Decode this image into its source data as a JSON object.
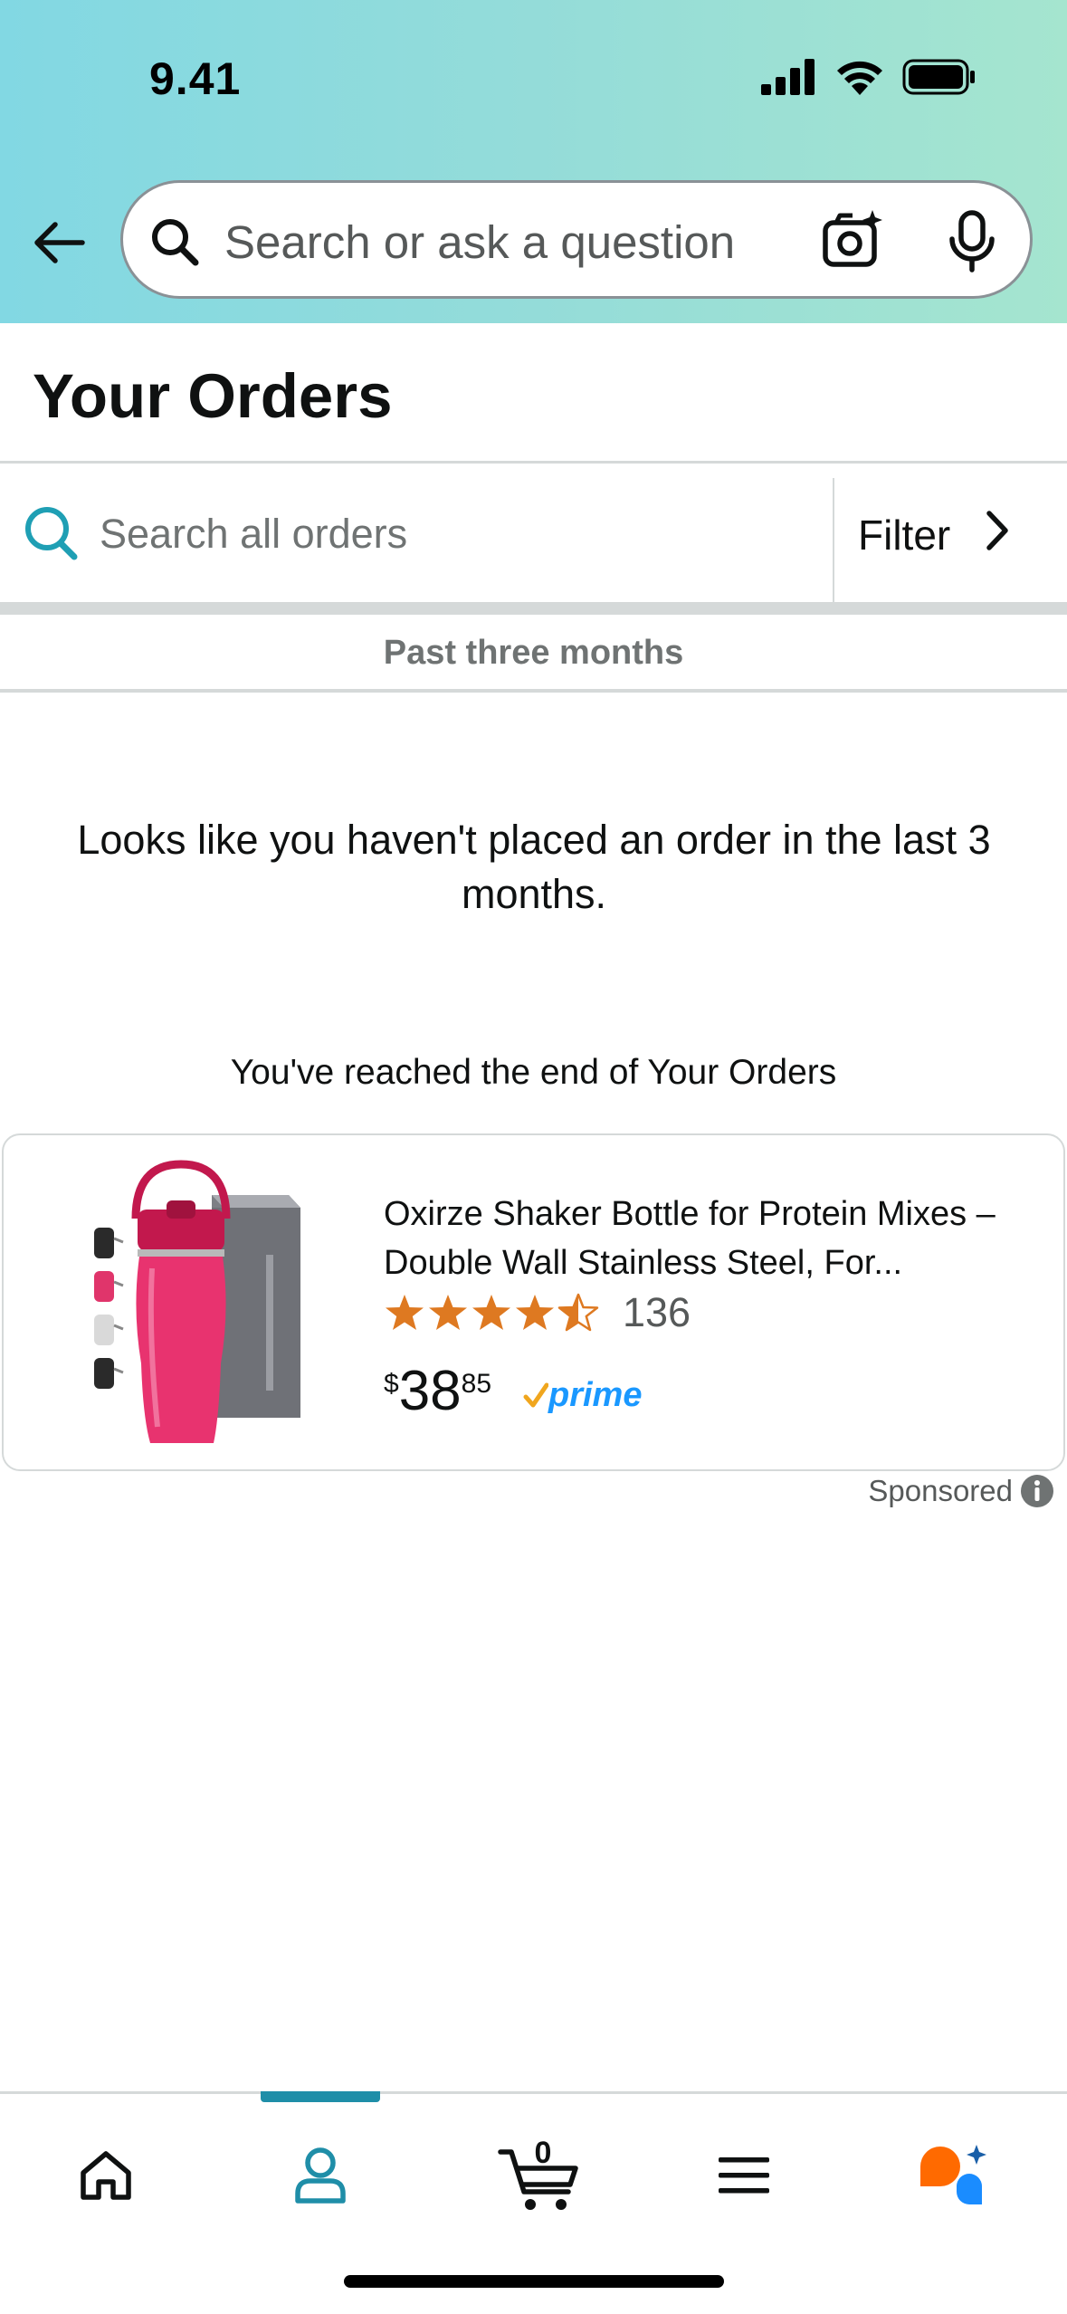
{
  "status_bar": {
    "time": "9.41"
  },
  "header": {
    "search_placeholder": "Search or ask a question"
  },
  "page": {
    "title": "Your Orders"
  },
  "order_search": {
    "placeholder": "Search all orders",
    "filter_label": "Filter"
  },
  "period": {
    "label": "Past three months"
  },
  "messages": {
    "empty": "Looks like you haven't placed an order in the last 3 months.",
    "end": "You've reached the end of Your Orders"
  },
  "sponsored_product": {
    "title": "Oxirze Shaker Bottle for Protein Mixes – Double Wall Stainless Steel, For...",
    "rating": 4.5,
    "review_count": "136",
    "price_symbol": "$",
    "price_whole": "38",
    "price_fraction": "85",
    "prime_label": "prime",
    "sponsored_label": "Sponsored"
  },
  "bottom_nav": {
    "active": "account",
    "cart_count": "0",
    "items": [
      "home",
      "account",
      "cart",
      "menu",
      "rufus"
    ]
  },
  "colors": {
    "accent": "#1f8ea8",
    "star": "#de7921",
    "prime_blue": "#1a98ff",
    "header_gradient_start": "#82d8e3",
    "header_gradient_end": "#a5e5cf"
  }
}
